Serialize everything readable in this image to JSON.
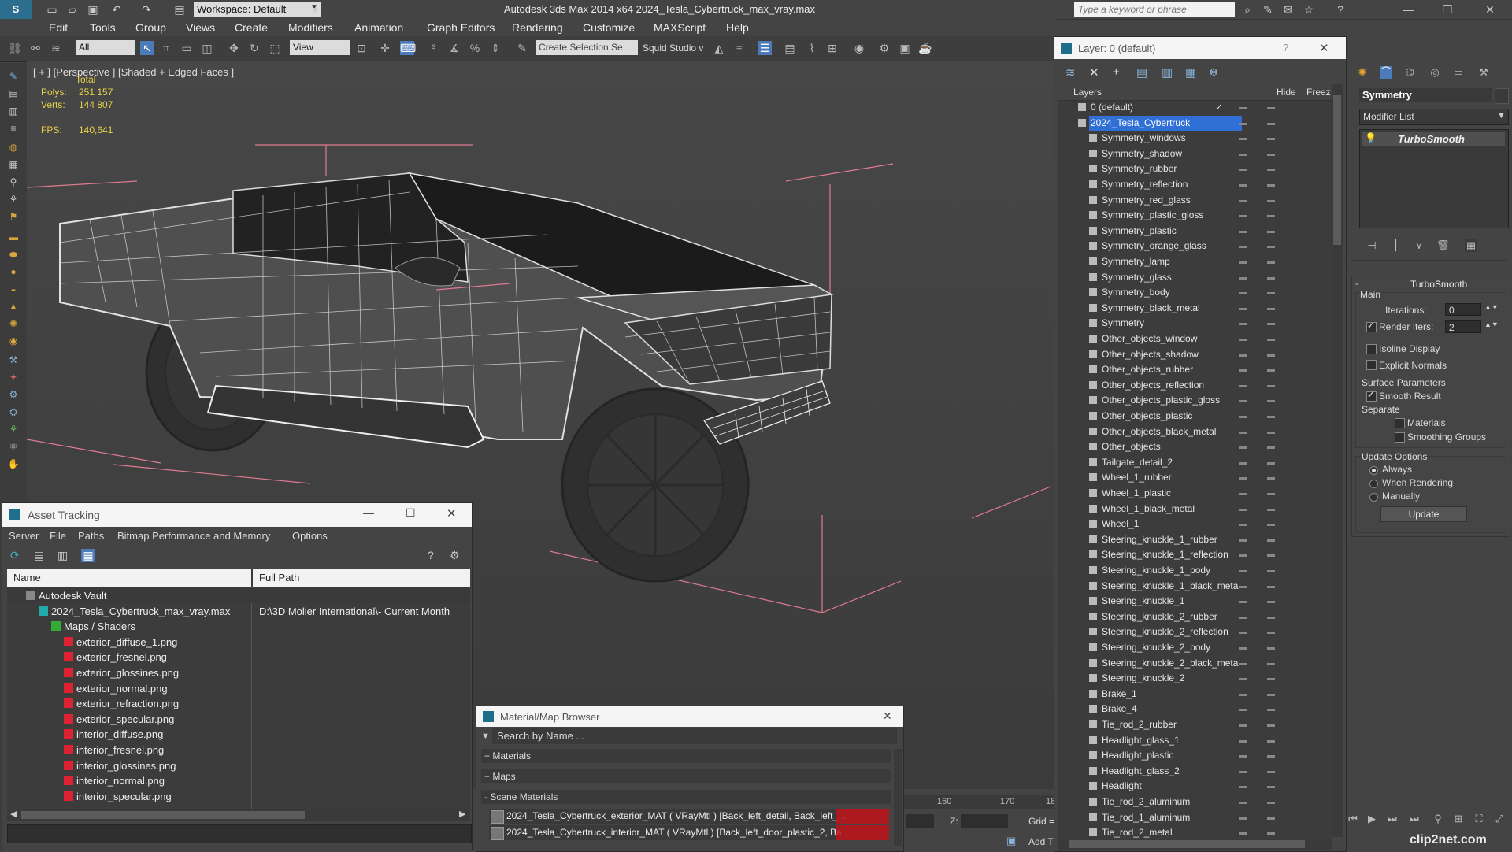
{
  "app": {
    "workspace": "Workspace: Default",
    "title": "Autodesk 3ds Max  2014 x64     2024_Tesla_Cybertruck_max_vray.max",
    "search_placeholder": "Type a keyword or phrase"
  },
  "menu": [
    "Edit",
    "Tools",
    "Group",
    "Views",
    "Create",
    "Modifiers",
    "Animation",
    "Graph Editors",
    "Rendering",
    "Customize",
    "MAXScript",
    "Help"
  ],
  "toolbar": {
    "filter": "All",
    "view": "View",
    "selection_set": "Create Selection Se",
    "squid": "Squid Studio v"
  },
  "viewport": {
    "label": "[ + ] [Perspective ] [Shaded + Edged Faces ]",
    "total_label": "Total",
    "polys_label": "Polys:",
    "polys_value": "251 157",
    "verts_label": "Verts:",
    "verts_value": "144 807",
    "fps_label": "FPS:",
    "fps_value": "140,641"
  },
  "asset_tracking": {
    "title": "Asset Tracking",
    "menu": [
      "Server",
      "File",
      "Paths",
      "Bitmap Performance and Memory",
      "Options"
    ],
    "col_name": "Name",
    "col_path": "Full Path",
    "rows": [
      {
        "name": "Autodesk Vault",
        "path": "",
        "indent": 1,
        "icon": "vault-icon"
      },
      {
        "name": "2024_Tesla_Cybertruck_max_vray.max",
        "path": "D:\\3D Molier International\\- Current Month",
        "indent": 2,
        "icon": "max-file-icon"
      },
      {
        "name": "Maps / Shaders",
        "path": "",
        "indent": 3,
        "icon": "maps-folder-icon"
      },
      {
        "name": "exterior_diffuse_1.png",
        "path": "",
        "indent": 4,
        "icon": "png-icon"
      },
      {
        "name": "exterior_fresnel.png",
        "path": "",
        "indent": 4,
        "icon": "png-icon"
      },
      {
        "name": "exterior_glossines.png",
        "path": "",
        "indent": 4,
        "icon": "png-icon"
      },
      {
        "name": "exterior_normal.png",
        "path": "",
        "indent": 4,
        "icon": "png-icon"
      },
      {
        "name": "exterior_refraction.png",
        "path": "",
        "indent": 4,
        "icon": "png-icon"
      },
      {
        "name": "exterior_specular.png",
        "path": "",
        "indent": 4,
        "icon": "png-icon"
      },
      {
        "name": "interior_diffuse.png",
        "path": "",
        "indent": 4,
        "icon": "png-icon"
      },
      {
        "name": "interior_fresnel.png",
        "path": "",
        "indent": 4,
        "icon": "png-icon"
      },
      {
        "name": "interior_glossines.png",
        "path": "",
        "indent": 4,
        "icon": "png-icon"
      },
      {
        "name": "interior_normal.png",
        "path": "",
        "indent": 4,
        "icon": "png-icon"
      },
      {
        "name": "interior_specular.png",
        "path": "",
        "indent": 4,
        "icon": "png-icon"
      }
    ]
  },
  "material_browser": {
    "title": "Material/Map Browser",
    "search_placeholder": "Search by Name ...",
    "sections": [
      "+ Materials",
      "+ Maps",
      "- Scene Materials"
    ],
    "scene_materials": [
      "2024_Tesla_Cybertruck_exterior_MAT ( VRayMtl ) [Back_left_detail, Back_left_...",
      "2024_Tesla_Cybertruck_interior_MAT ( VRayMtl ) [Back_left_door_plastic_2, Ba..."
    ]
  },
  "timeline": {
    "ticks": [
      "160",
      "170",
      "18"
    ],
    "z_label": "Z:",
    "grid_label": "Grid =",
    "add_label": "Add T"
  },
  "layers": {
    "title": "Layer: 0 (default)",
    "col_layers": "Layers",
    "col_hide": "Hide",
    "col_freeze": "Freez",
    "default_layer": "0 (default)",
    "selected_layer": "2024_Tesla_Cybertruck",
    "items": [
      "Symmetry_windows",
      "Symmetry_shadow",
      "Symmetry_rubber",
      "Symmetry_reflection",
      "Symmetry_red_glass",
      "Symmetry_plastic_gloss",
      "Symmetry_plastic",
      "Symmetry_orange_glass",
      "Symmetry_lamp",
      "Symmetry_glass",
      "Symmetry_body",
      "Symmetry_black_metal",
      "Symmetry",
      "Other_objects_window",
      "Other_objects_shadow",
      "Other_objects_rubber",
      "Other_objects_reflection",
      "Other_objects_plastic_gloss",
      "Other_objects_plastic",
      "Other_objects_black_metal",
      "Other_objects",
      "Tailgate_detail_2",
      "Wheel_1_rubber",
      "Wheel_1_plastic",
      "Wheel_1_black_metal",
      "Wheel_1",
      "Steering_knuckle_1_rubber",
      "Steering_knuckle_1_reflection",
      "Steering_knuckle_1_body",
      "Steering_knuckle_1_black_meta",
      "Steering_knuckle_1",
      "Steering_knuckle_2_rubber",
      "Steering_knuckle_2_reflection",
      "Steering_knuckle_2_body",
      "Steering_knuckle_2_black_meta",
      "Steering_knuckle_2",
      "Brake_1",
      "Brake_4",
      "Tie_rod_2_rubber",
      "Headlight_glass_1",
      "Headlight_plastic",
      "Headlight_glass_2",
      "Headlight",
      "Tie_rod_2_aluminum",
      "Tie_rod_1_aluminum",
      "Tie_rod_2_metal"
    ]
  },
  "command_panel": {
    "object_name": "Symmetry",
    "modifier_list": "Modifier List",
    "stack_item": "TurboSmooth",
    "rollout_title": "TurboSmooth",
    "main_label": "Main",
    "iterations_label": "Iterations:",
    "iterations_value": "0",
    "render_iters_label": "Render Iters:",
    "render_iters_value": "2",
    "isoline_label": "Isoline Display",
    "explicit_label": "Explicit Normals",
    "surface_label": "Surface Parameters",
    "smooth_label": "Smooth Result",
    "separate_label": "Separate",
    "materials_label": "Materials",
    "smoothing_label": "Smoothing Groups",
    "update_options_label": "Update Options",
    "always_label": "Always",
    "when_rendering_label": "When Rendering",
    "manually_label": "Manually",
    "update_button": "Update"
  },
  "watermark": "clip2net.com"
}
